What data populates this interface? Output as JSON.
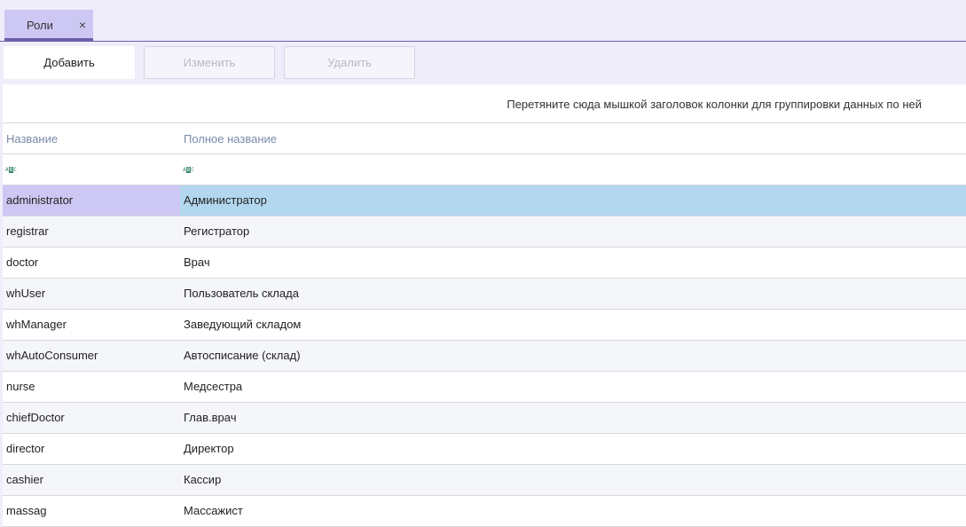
{
  "tabs": [
    {
      "label": "Роли",
      "close": "×"
    }
  ],
  "toolbar": {
    "add_label": "Добавить",
    "edit_label": "Изменить",
    "delete_label": "Удалить"
  },
  "grid": {
    "group_panel_text": "Перетяните сюда мышкой заголовок колонки для группировки данных по ней",
    "columns": [
      "Название",
      "Полное название"
    ],
    "filter_icon": "abc-filter-icon",
    "rows": [
      {
        "name": "administrator",
        "full_name": "Администратор"
      },
      {
        "name": "registrar",
        "full_name": "Регистратор"
      },
      {
        "name": "doctor",
        "full_name": "Врач"
      },
      {
        "name": "whUser",
        "full_name": "Пользователь склада"
      },
      {
        "name": "whManager",
        "full_name": "Заведующий складом"
      },
      {
        "name": "whAutoConsumer",
        "full_name": "Автосписание (склад)"
      },
      {
        "name": "nurse",
        "full_name": "Медсестра"
      },
      {
        "name": "chiefDoctor",
        "full_name": "Глав.врач"
      },
      {
        "name": "director",
        "full_name": "Директор"
      },
      {
        "name": "cashier",
        "full_name": "Кассир"
      },
      {
        "name": "massag",
        "full_name": "Массажист"
      }
    ],
    "selected_row": 0
  },
  "colors": {
    "accent": "#6b5fa8",
    "tab_bg": "#cdc8f3",
    "selected_row": "#b3d7ef",
    "header_text": "#7b8aa8"
  }
}
